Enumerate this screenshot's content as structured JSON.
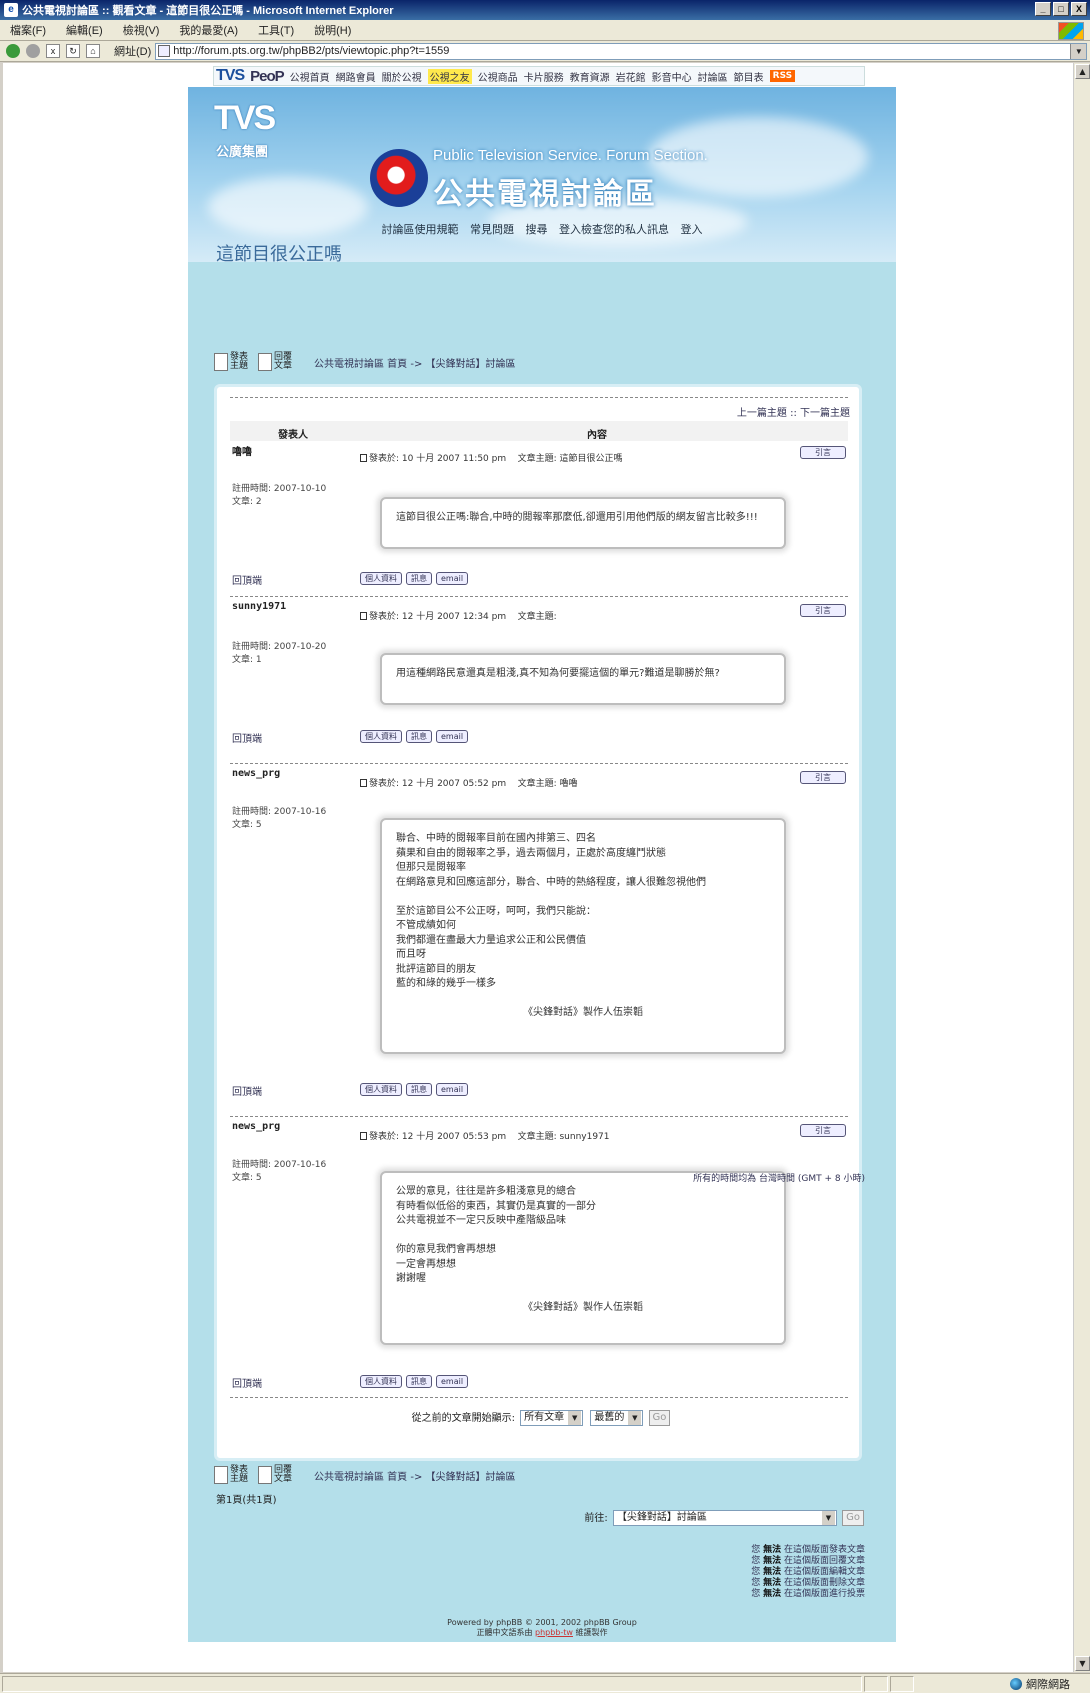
{
  "window": {
    "title": "公共電視討論區 :: 觀看文章 - 這節目很公正嗎 - Microsoft Internet Explorer",
    "controls": [
      "_",
      "□",
      "X"
    ]
  },
  "menu": [
    "檔案(F)",
    "編輯(E)",
    "檢視(V)",
    "我的最愛(A)",
    "工具(T)",
    "說明(H)"
  ],
  "address": {
    "label": "網址(D)",
    "url": "http://forum.pts.org.tw/phpBB2/pts/viewtopic.php?t=1559"
  },
  "topnav": {
    "logo1": "TVS",
    "logo2": "PeoP",
    "links": [
      "公視首頁",
      "網路會員",
      "關於公視",
      "公視之友",
      "公視商品",
      "卡片服務",
      "教育資源",
      "岩花館",
      "影音中心",
      "討論區",
      "節目表"
    ],
    "highlight_index": 3,
    "rss": "RSS"
  },
  "banner": {
    "group_logo": "TVS",
    "group_sub": "公廣集團",
    "en_title": "Public Television Service. Forum Section.",
    "zh_title": "公共電視討論區"
  },
  "header_links": [
    "討論區使用規範",
    "常見問題",
    "搜尋",
    "登入檢查您的私人訊息",
    "登入"
  ],
  "topic_title": "這節目很公正嗎",
  "buttons": {
    "new_topic": "發表主題",
    "reply": "回覆文章"
  },
  "breadcrumb": "公共電視討論區 首頁 -> 【尖鋒對話】討論區",
  "prev_next": "上一篇主題 :: 下一篇主題",
  "table_headers": {
    "author": "發表人",
    "content": "內容"
  },
  "posts": [
    {
      "author": "嚕嚕",
      "posted": "發表於: 10 十月 2007 11:50 pm",
      "subject": "文章主題: 這節目很公正嗎",
      "joined": "註冊時間: 2007-10-10",
      "count": "文章: 2",
      "lines": [
        "這節目很公正嗎:聯合,中時的閱報率那麼低,卻還用引用他們版的網友留言比較多!!!"
      ],
      "signature": ""
    },
    {
      "author": "sunny1971",
      "posted": "發表於: 12 十月 2007 12:34 pm",
      "subject": "文章主題:",
      "joined": "註冊時間: 2007-10-20",
      "count": "文章: 1",
      "lines": [
        "用這種網路民意還真是粗淺,真不知為何要擺這個的單元?難道是聊勝於無?"
      ],
      "signature": ""
    },
    {
      "author": "news_prg",
      "posted": "發表於: 12 十月 2007 05:52 pm",
      "subject": "文章主題: 嚕嚕",
      "joined": "註冊時間: 2007-10-16",
      "count": "文章: 5",
      "lines": [
        "聯合、中時的閱報率目前在國內排第三、四名",
        "蘋果和自由的閱報率之爭，過去兩個月，正處於高度纏鬥狀態",
        "但那只是閱報率",
        "在網路意見和回應這部分，聯合、中時的熱絡程度，讓人很難忽視他們",
        "",
        "至於這節目公不公正呀，呵呵，我們只能說：",
        "不管成績如何",
        "我們都還在盡最大力量追求公正和公民價值",
        "而且呀",
        "批評這節目的朋友",
        "藍的和綠的幾乎一樣多"
      ],
      "signature": "《尖鋒對話》製作人伍崇韜"
    },
    {
      "author": "news_prg",
      "posted": "發表於: 12 十月 2007 05:53 pm",
      "subject": "文章主題: sunny1971",
      "joined": "註冊時間: 2007-10-16",
      "count": "文章: 5",
      "lines": [
        "公眾的意見，往往是許多粗淺意見的總合",
        "有時看似低俗的東西，其實仍是真實的一部分",
        "公共電視並不一定只反映中產階級品味",
        "",
        "你的意見我們會再想想",
        "一定會再想想",
        "謝謝喔"
      ],
      "signature": "《尖鋒對話》製作人伍崇韜"
    }
  ],
  "post_actions": {
    "to_top": "回頂端",
    "quote": "引言",
    "profile": "個人資料",
    "pm": "訊息",
    "email": "email"
  },
  "filter": {
    "label": "從之前的文章開始顯示:",
    "range": "所有文章",
    "order": "最舊的",
    "go": "Go"
  },
  "footer": {
    "timezone": "所有的時間均為 台灣時間 (GMT + 8 小時)",
    "pages": "第1頁(共1頁)",
    "jump_label": "前往:",
    "jump_value": "【尖鋒對話】討論區",
    "go": "Go",
    "permissions": [
      {
        "pre": "您 ",
        "bold": "無法",
        "post": " 在這個版面發表文章"
      },
      {
        "pre": "您 ",
        "bold": "無法",
        "post": " 在這個版面回覆文章"
      },
      {
        "pre": "您 ",
        "bold": "無法",
        "post": " 在這個版面編輯文章"
      },
      {
        "pre": "您 ",
        "bold": "無法",
        "post": " 在這個版面刪除文章"
      },
      {
        "pre": "您 ",
        "bold": "無法",
        "post": " 在這個版面進行投票"
      }
    ],
    "powered1": "Powered by phpBB © 2001, 2002 phpBB Group",
    "powered2a": "正體中文語系由 ",
    "powered2b": "phpbb-tw",
    "powered2c": " 維護製作"
  },
  "status": {
    "zone": "網際網路"
  }
}
